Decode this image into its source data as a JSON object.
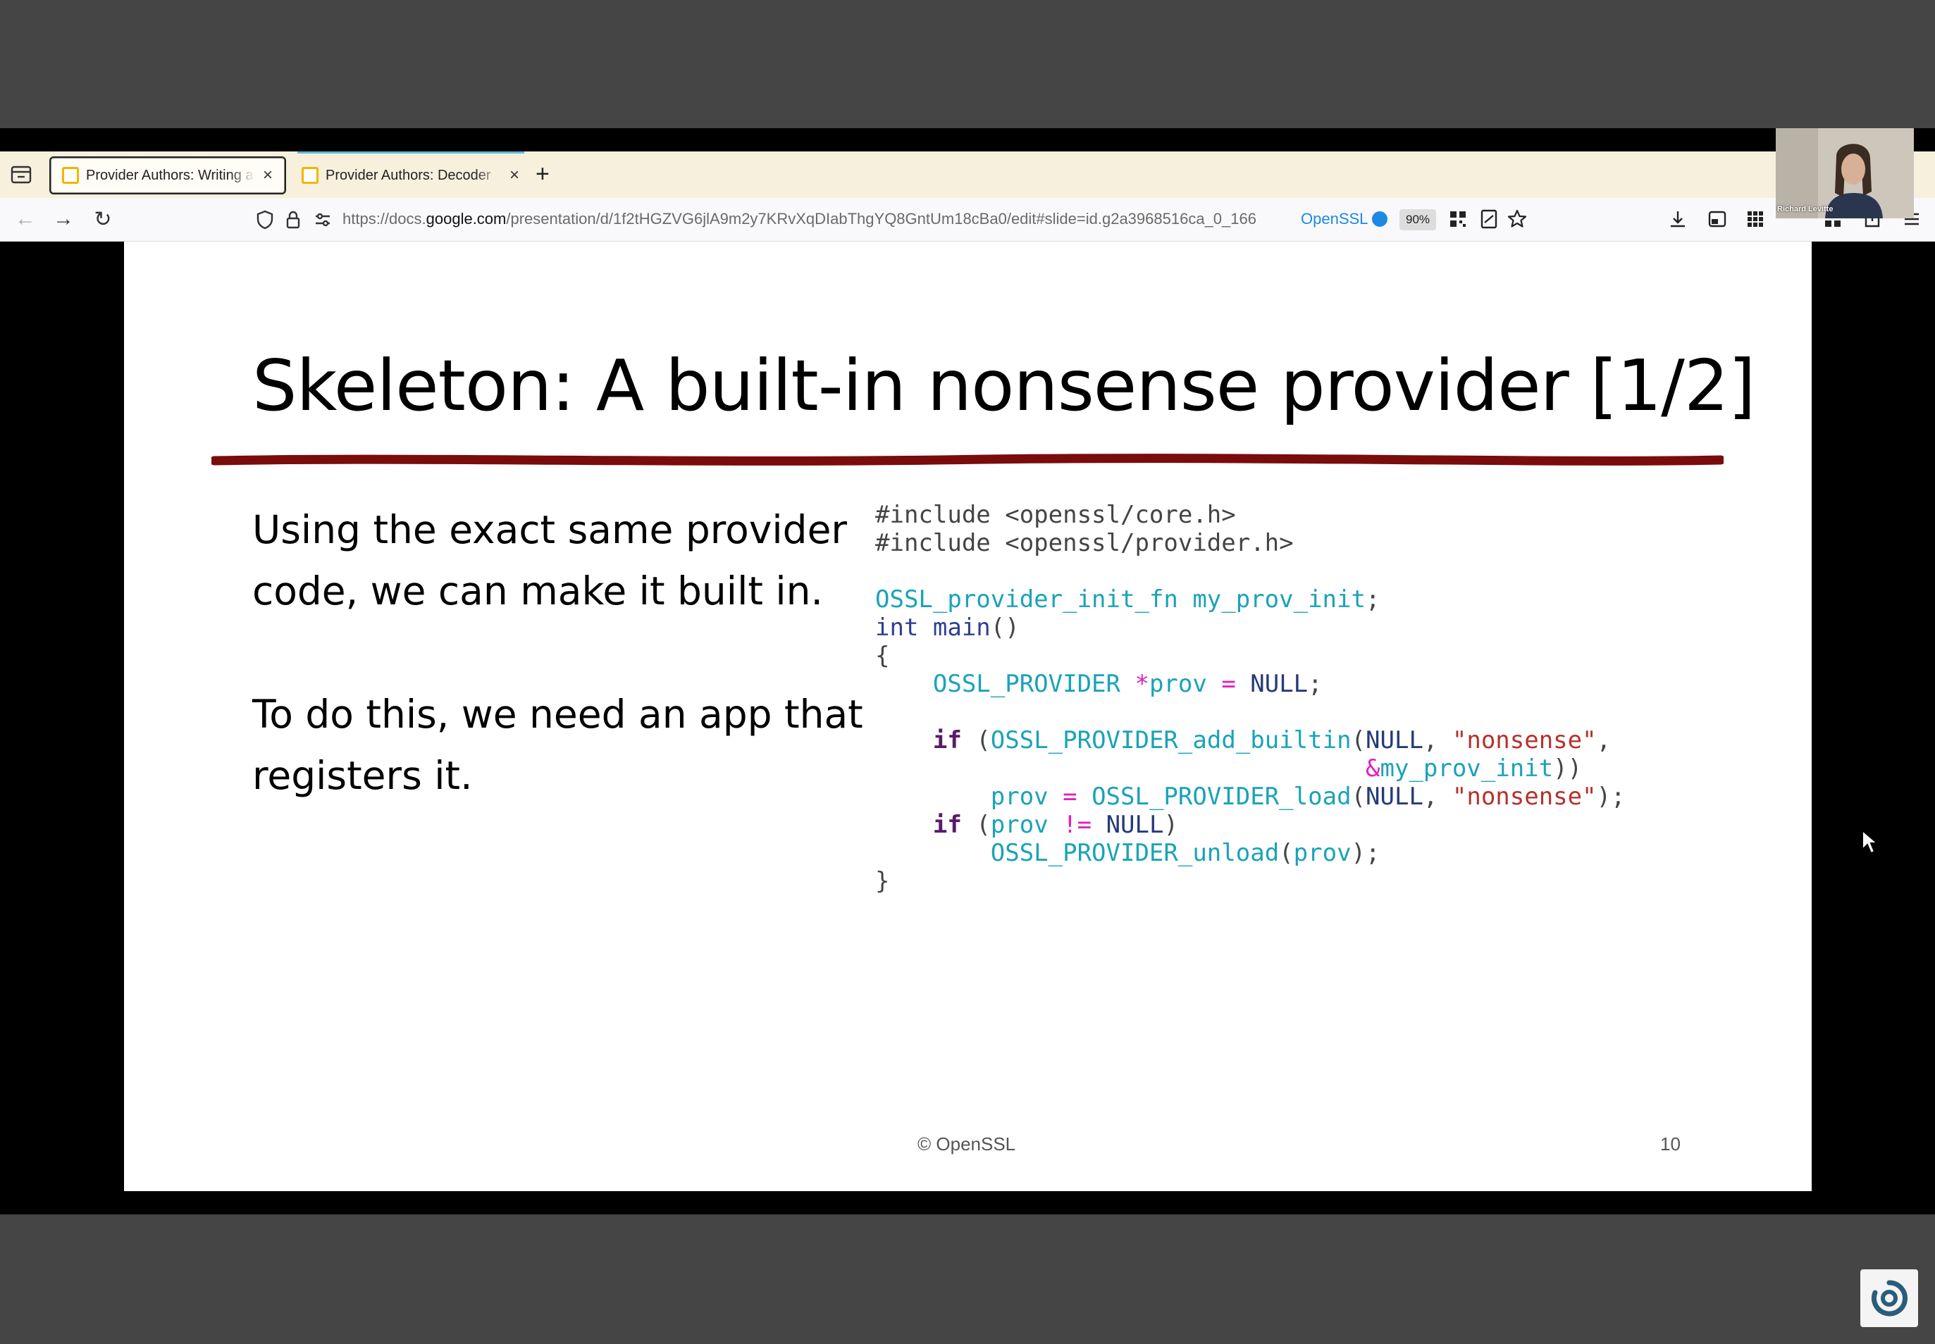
{
  "browser": {
    "tabs": [
      {
        "title": "Provider Authors: Writing a",
        "close": "×"
      },
      {
        "title": "Provider Authors: Decoder",
        "close": "×"
      }
    ],
    "new_tab": "+",
    "nav": {
      "back": "←",
      "forward": "→",
      "reload": "↻"
    },
    "url": {
      "prefix": "https://docs.",
      "host": "google.com",
      "path": "/presentation/d/1f2tHGZVG6jlA9m2y7KRvXqDIabThgYQ8GntUm18cBa0/edit#slide=id.g2a3968516ca_0_166"
    },
    "extension_label": "OpenSSL",
    "zoom": "90%"
  },
  "slide": {
    "title": "Skeleton: A built-in nonsense provider [1/2]",
    "paragraph1": [
      "Using the exact same provider",
      "code, we can make it built in."
    ],
    "paragraph2": [
      "To do this, we need an app that",
      "registers it."
    ],
    "code_lines": [
      [
        {
          "t": "#include <openssl/core.h>",
          "c": "pp"
        }
      ],
      [
        {
          "t": "#include <openssl/provider.h>",
          "c": "pp"
        }
      ],
      [],
      [
        {
          "t": "OSSL_provider_init_fn my_prov_init",
          "c": "type"
        },
        {
          "t": ";",
          "c": "pp"
        }
      ],
      [
        {
          "t": "int ",
          "c": "fn"
        },
        {
          "t": "main",
          "c": "fn"
        },
        {
          "t": "()",
          "c": "pp"
        }
      ],
      [
        {
          "t": "{",
          "c": "pp"
        }
      ],
      [
        {
          "t": "    ",
          "c": "pp"
        },
        {
          "t": "OSSL_PROVIDER ",
          "c": "type"
        },
        {
          "t": "*",
          "c": "op"
        },
        {
          "t": "prov ",
          "c": "var"
        },
        {
          "t": "= ",
          "c": "op"
        },
        {
          "t": "NULL",
          "c": "null"
        },
        {
          "t": ";",
          "c": "pp"
        }
      ],
      [],
      [
        {
          "t": "    ",
          "c": "pp"
        },
        {
          "t": "if",
          "c": "kw"
        },
        {
          "t": " (",
          "c": "pp"
        },
        {
          "t": "OSSL_PROVIDER_add_builtin",
          "c": "type"
        },
        {
          "t": "(",
          "c": "pp"
        },
        {
          "t": "NULL",
          "c": "null"
        },
        {
          "t": ", ",
          "c": "pp"
        },
        {
          "t": "\"nonsense\"",
          "c": "str"
        },
        {
          "t": ",",
          "c": "pp"
        }
      ],
      [
        {
          "t": "                                  ",
          "c": "pp"
        },
        {
          "t": "&",
          "c": "op"
        },
        {
          "t": "my_prov_init",
          "c": "var"
        },
        {
          "t": "))",
          "c": "pp"
        }
      ],
      [
        {
          "t": "        ",
          "c": "pp"
        },
        {
          "t": "prov ",
          "c": "var"
        },
        {
          "t": "= ",
          "c": "op"
        },
        {
          "t": "OSSL_PROVIDER_load",
          "c": "type"
        },
        {
          "t": "(",
          "c": "pp"
        },
        {
          "t": "NULL",
          "c": "null"
        },
        {
          "t": ", ",
          "c": "pp"
        },
        {
          "t": "\"nonsense\"",
          "c": "str"
        },
        {
          "t": ");",
          "c": "pp"
        }
      ],
      [
        {
          "t": "    ",
          "c": "pp"
        },
        {
          "t": "if",
          "c": "kw"
        },
        {
          "t": " (",
          "c": "pp"
        },
        {
          "t": "prov ",
          "c": "var"
        },
        {
          "t": "!= ",
          "c": "op"
        },
        {
          "t": "NULL",
          "c": "null"
        },
        {
          "t": ")",
          "c": "pp"
        }
      ],
      [
        {
          "t": "        ",
          "c": "pp"
        },
        {
          "t": "OSSL_PROVIDER_unload",
          "c": "type"
        },
        {
          "t": "(",
          "c": "pp"
        },
        {
          "t": "prov",
          "c": "var"
        },
        {
          "t": ");",
          "c": "pp"
        }
      ],
      [
        {
          "t": "}",
          "c": "pp"
        }
      ]
    ],
    "footer": "© OpenSSL",
    "page_number": "10"
  },
  "webcam": {
    "name": "Richard Levitte"
  },
  "colors": {
    "rule": "#7a0c0c",
    "tab_bar": "#f7f0dd",
    "frame_gray": "#454545"
  }
}
